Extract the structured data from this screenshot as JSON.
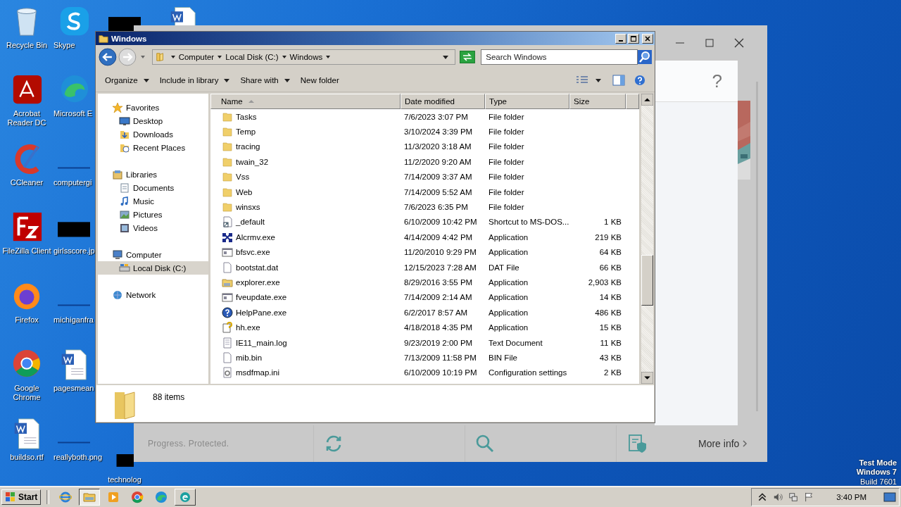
{
  "desktop": {
    "columns": [
      [
        {
          "kind": "recycle",
          "label": "Recycle Bin"
        },
        {
          "kind": "acrobat",
          "label": "Acrobat Reader DC"
        },
        {
          "kind": "ccleaner",
          "label": "CCleaner"
        },
        {
          "kind": "filezilla",
          "label": "FileZilla Client"
        },
        {
          "kind": "firefox",
          "label": "Firefox"
        },
        {
          "kind": "chrome",
          "label": "Google Chrome"
        },
        {
          "kind": "word",
          "label": "buildso.rtf"
        }
      ],
      [
        {
          "kind": "skype",
          "label": "Skype"
        },
        {
          "kind": "edge",
          "label": "Microsoft E"
        },
        {
          "kind": "image-light",
          "label": "computergi"
        },
        {
          "kind": "image-dark",
          "label": "girlsscore.jp"
        },
        {
          "kind": "image-light",
          "label": "michiganfra"
        },
        {
          "kind": "word",
          "label": "pagesmean"
        },
        {
          "kind": "image-light",
          "label": "reallyboth.png"
        }
      ],
      [
        {
          "kind": "image-dark"
        },
        {
          "kind": "image-dark",
          "label": "technolog"
        }
      ],
      [
        {
          "kind": "word"
        }
      ]
    ]
  },
  "background_window": {
    "help": "?",
    "footer_text": "Progress. Protected.",
    "more_info": "More info"
  },
  "explorer": {
    "title": "Windows",
    "address": [
      "Computer",
      "Local Disk (C:)",
      "Windows"
    ],
    "search": {
      "placeholder": "Search Windows"
    },
    "toolbar": [
      {
        "label": "Organize",
        "menu": true
      },
      {
        "label": "Include in library",
        "menu": true
      },
      {
        "label": "Share with",
        "menu": true
      },
      {
        "label": "New folder",
        "menu": false
      }
    ],
    "nav": [
      {
        "label": "Favorites",
        "kind": "star",
        "selected": false,
        "children": [
          {
            "label": "Desktop",
            "kind": "desktop",
            "selected": false
          },
          {
            "label": "Downloads",
            "kind": "download",
            "selected": false
          },
          {
            "label": "Recent Places",
            "kind": "recent",
            "selected": false
          }
        ]
      },
      {
        "label": "Libraries",
        "kind": "library",
        "selected": false,
        "children": [
          {
            "label": "Documents",
            "kind": "documents",
            "selected": false
          },
          {
            "label": "Music",
            "kind": "music",
            "selected": false
          },
          {
            "label": "Pictures",
            "kind": "pictures",
            "selected": false
          },
          {
            "label": "Videos",
            "kind": "videos",
            "selected": false
          }
        ]
      },
      {
        "label": "Computer",
        "kind": "computer",
        "selected": false,
        "children": [
          {
            "label": "Local Disk (C:)",
            "kind": "disk",
            "selected": true
          }
        ]
      },
      {
        "label": "Network",
        "kind": "network",
        "selected": false
      }
    ],
    "columns": [
      {
        "label": "Name",
        "sorted": true
      },
      {
        "label": "Date modified",
        "sorted": false
      },
      {
        "label": "Type",
        "sorted": false
      },
      {
        "label": "Size",
        "sorted": false
      }
    ],
    "rows": [
      {
        "kind": "folder",
        "name": "Tasks",
        "date": "7/6/2023 3:07 PM",
        "type": "File folder"
      },
      {
        "kind": "folder",
        "name": "Temp",
        "date": "3/10/2024 3:39 PM",
        "type": "File folder"
      },
      {
        "kind": "folder",
        "name": "tracing",
        "date": "11/3/2020 3:18 AM",
        "type": "File folder"
      },
      {
        "kind": "folder",
        "name": "twain_32",
        "date": "11/2/2020 9:20 AM",
        "type": "File folder"
      },
      {
        "kind": "folder",
        "name": "Vss",
        "date": "7/14/2009 3:37 AM",
        "type": "File folder"
      },
      {
        "kind": "folder",
        "name": "Web",
        "date": "7/14/2009 5:52 AM",
        "type": "File folder"
      },
      {
        "kind": "folder",
        "name": "winsxs",
        "date": "7/6/2023 6:35 PM",
        "type": "File folder"
      },
      {
        "kind": "shortcut",
        "name": "_default",
        "date": "6/10/2009 10:42 PM",
        "type": "Shortcut to MS-DOS...",
        "size": "1 KB"
      },
      {
        "kind": "network-app",
        "name": "Alcrmv.exe",
        "date": "4/14/2009 4:42 PM",
        "type": "Application",
        "size": "219 KB"
      },
      {
        "kind": "window-app",
        "name": "bfsvc.exe",
        "date": "11/20/2010 9:29 PM",
        "type": "Application",
        "size": "64 KB"
      },
      {
        "kind": "blank",
        "name": "bootstat.dat",
        "date": "12/15/2023 7:28 AM",
        "type": "DAT File",
        "size": "66 KB"
      },
      {
        "kind": "explorer",
        "name": "explorer.exe",
        "date": "8/29/2016 3:55 PM",
        "type": "Application",
        "size": "2,903 KB"
      },
      {
        "kind": "window-app",
        "name": "fveupdate.exe",
        "date": "7/14/2009 2:14 AM",
        "type": "Application",
        "size": "14 KB"
      },
      {
        "kind": "help",
        "name": "HelpPane.exe",
        "date": "6/2/2017 8:57 AM",
        "type": "Application",
        "size": "486 KB"
      },
      {
        "kind": "help-doc",
        "name": "hh.exe",
        "date": "4/18/2018 4:35 PM",
        "type": "Application",
        "size": "15 KB"
      },
      {
        "kind": "text",
        "name": "IE11_main.log",
        "date": "9/23/2019 2:00 PM",
        "type": "Text Document",
        "size": "11 KB"
      },
      {
        "kind": "blank",
        "name": "mib.bin",
        "date": "7/13/2009 11:58 PM",
        "type": "BIN File",
        "size": "43 KB"
      },
      {
        "kind": "config",
        "name": "msdfmap.ini",
        "date": "6/10/2009 10:19 PM",
        "type": "Configuration settings",
        "size": "2 KB"
      }
    ],
    "status": "88 items"
  },
  "os_notice": [
    "Test Mode",
    "Windows 7",
    "Build 7601"
  ],
  "taskbar": {
    "start": "Start",
    "apps": [
      {
        "kind": "ie",
        "open": false,
        "selected": false
      },
      {
        "kind": "explorer",
        "open": true,
        "selected": true
      },
      {
        "kind": "media",
        "open": false,
        "selected": false
      },
      {
        "kind": "chrome",
        "open": false,
        "selected": false
      },
      {
        "kind": "edge",
        "open": false,
        "selected": false
      },
      {
        "kind": "eset",
        "open": true,
        "selected": false
      }
    ],
    "clock": "3:40 PM"
  }
}
